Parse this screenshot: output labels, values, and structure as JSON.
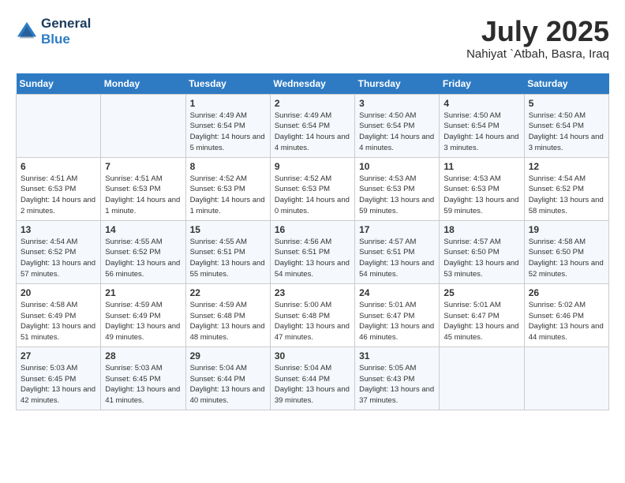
{
  "header": {
    "logo_line1": "General",
    "logo_line2": "Blue",
    "month": "July 2025",
    "location": "Nahiyat `Atbah, Basra, Iraq"
  },
  "weekdays": [
    "Sunday",
    "Monday",
    "Tuesday",
    "Wednesday",
    "Thursday",
    "Friday",
    "Saturday"
  ],
  "weeks": [
    [
      {
        "day": "",
        "info": ""
      },
      {
        "day": "",
        "info": ""
      },
      {
        "day": "1",
        "info": "Sunrise: 4:49 AM\nSunset: 6:54 PM\nDaylight: 14 hours and 5 minutes."
      },
      {
        "day": "2",
        "info": "Sunrise: 4:49 AM\nSunset: 6:54 PM\nDaylight: 14 hours and 4 minutes."
      },
      {
        "day": "3",
        "info": "Sunrise: 4:50 AM\nSunset: 6:54 PM\nDaylight: 14 hours and 4 minutes."
      },
      {
        "day": "4",
        "info": "Sunrise: 4:50 AM\nSunset: 6:54 PM\nDaylight: 14 hours and 3 minutes."
      },
      {
        "day": "5",
        "info": "Sunrise: 4:50 AM\nSunset: 6:54 PM\nDaylight: 14 hours and 3 minutes."
      }
    ],
    [
      {
        "day": "6",
        "info": "Sunrise: 4:51 AM\nSunset: 6:53 PM\nDaylight: 14 hours and 2 minutes."
      },
      {
        "day": "7",
        "info": "Sunrise: 4:51 AM\nSunset: 6:53 PM\nDaylight: 14 hours and 1 minute."
      },
      {
        "day": "8",
        "info": "Sunrise: 4:52 AM\nSunset: 6:53 PM\nDaylight: 14 hours and 1 minute."
      },
      {
        "day": "9",
        "info": "Sunrise: 4:52 AM\nSunset: 6:53 PM\nDaylight: 14 hours and 0 minutes."
      },
      {
        "day": "10",
        "info": "Sunrise: 4:53 AM\nSunset: 6:53 PM\nDaylight: 13 hours and 59 minutes."
      },
      {
        "day": "11",
        "info": "Sunrise: 4:53 AM\nSunset: 6:53 PM\nDaylight: 13 hours and 59 minutes."
      },
      {
        "day": "12",
        "info": "Sunrise: 4:54 AM\nSunset: 6:52 PM\nDaylight: 13 hours and 58 minutes."
      }
    ],
    [
      {
        "day": "13",
        "info": "Sunrise: 4:54 AM\nSunset: 6:52 PM\nDaylight: 13 hours and 57 minutes."
      },
      {
        "day": "14",
        "info": "Sunrise: 4:55 AM\nSunset: 6:52 PM\nDaylight: 13 hours and 56 minutes."
      },
      {
        "day": "15",
        "info": "Sunrise: 4:55 AM\nSunset: 6:51 PM\nDaylight: 13 hours and 55 minutes."
      },
      {
        "day": "16",
        "info": "Sunrise: 4:56 AM\nSunset: 6:51 PM\nDaylight: 13 hours and 54 minutes."
      },
      {
        "day": "17",
        "info": "Sunrise: 4:57 AM\nSunset: 6:51 PM\nDaylight: 13 hours and 54 minutes."
      },
      {
        "day": "18",
        "info": "Sunrise: 4:57 AM\nSunset: 6:50 PM\nDaylight: 13 hours and 53 minutes."
      },
      {
        "day": "19",
        "info": "Sunrise: 4:58 AM\nSunset: 6:50 PM\nDaylight: 13 hours and 52 minutes."
      }
    ],
    [
      {
        "day": "20",
        "info": "Sunrise: 4:58 AM\nSunset: 6:49 PM\nDaylight: 13 hours and 51 minutes."
      },
      {
        "day": "21",
        "info": "Sunrise: 4:59 AM\nSunset: 6:49 PM\nDaylight: 13 hours and 49 minutes."
      },
      {
        "day": "22",
        "info": "Sunrise: 4:59 AM\nSunset: 6:48 PM\nDaylight: 13 hours and 48 minutes."
      },
      {
        "day": "23",
        "info": "Sunrise: 5:00 AM\nSunset: 6:48 PM\nDaylight: 13 hours and 47 minutes."
      },
      {
        "day": "24",
        "info": "Sunrise: 5:01 AM\nSunset: 6:47 PM\nDaylight: 13 hours and 46 minutes."
      },
      {
        "day": "25",
        "info": "Sunrise: 5:01 AM\nSunset: 6:47 PM\nDaylight: 13 hours and 45 minutes."
      },
      {
        "day": "26",
        "info": "Sunrise: 5:02 AM\nSunset: 6:46 PM\nDaylight: 13 hours and 44 minutes."
      }
    ],
    [
      {
        "day": "27",
        "info": "Sunrise: 5:03 AM\nSunset: 6:45 PM\nDaylight: 13 hours and 42 minutes."
      },
      {
        "day": "28",
        "info": "Sunrise: 5:03 AM\nSunset: 6:45 PM\nDaylight: 13 hours and 41 minutes."
      },
      {
        "day": "29",
        "info": "Sunrise: 5:04 AM\nSunset: 6:44 PM\nDaylight: 13 hours and 40 minutes."
      },
      {
        "day": "30",
        "info": "Sunrise: 5:04 AM\nSunset: 6:44 PM\nDaylight: 13 hours and 39 minutes."
      },
      {
        "day": "31",
        "info": "Sunrise: 5:05 AM\nSunset: 6:43 PM\nDaylight: 13 hours and 37 minutes."
      },
      {
        "day": "",
        "info": ""
      },
      {
        "day": "",
        "info": ""
      }
    ]
  ]
}
